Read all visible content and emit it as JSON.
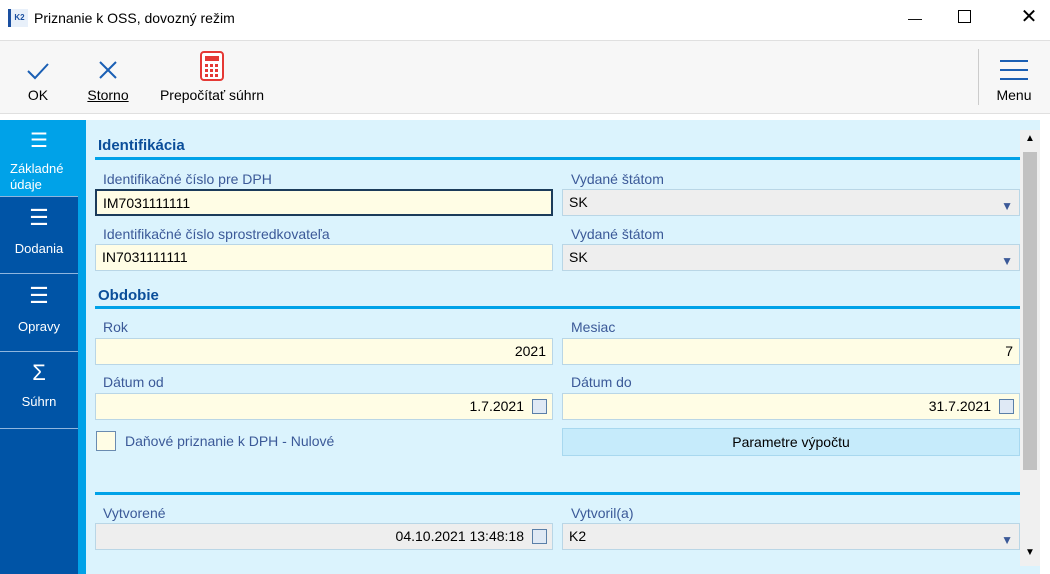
{
  "window": {
    "title": "Priznanie k OSS, dovozný režim"
  },
  "toolbar": {
    "ok": "OK",
    "storno": "Storno",
    "recalc": "Prepočítať súhrn",
    "menu": "Menu"
  },
  "sidebar": {
    "items": [
      {
        "label": "Základné údaje"
      },
      {
        "label": "Dodania"
      },
      {
        "label": "Opravy"
      },
      {
        "label": "Súhrn"
      }
    ]
  },
  "sections": {
    "identification": "Identifikácia",
    "period": "Obdobie"
  },
  "fields": {
    "vat_id_label": "Identifikačné číslo pre DPH",
    "vat_id": "IM7031111111",
    "issued_label": "Vydané štátom",
    "issued": "SK",
    "intermediary_label": "Identifikačné číslo sprostredkovateľa",
    "intermediary": "IN7031111111",
    "issued2_label": "Vydané štátom",
    "issued2": "SK",
    "year_label": "Rok",
    "year": "2021",
    "month_label": "Mesiac",
    "month": "7",
    "date_from_label": "Dátum od",
    "date_from": "1.7.2021",
    "date_to_label": "Dátum do",
    "date_to": "31.7.2021",
    "zero_label": "Daňové priznanie k DPH - Nulové",
    "params_button": "Parametre výpočtu",
    "created_label": "Vytvorené",
    "created": "04.10.2021 13:48:18",
    "created_by_label": "Vytvoril(a)",
    "created_by": "K2"
  }
}
